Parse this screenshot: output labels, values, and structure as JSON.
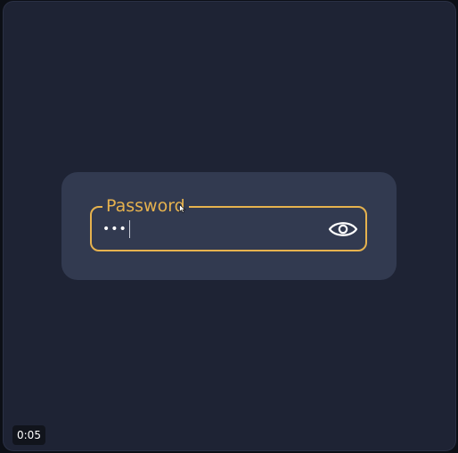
{
  "password_field": {
    "label": "Password",
    "masked_value": "•••",
    "visibility_toggle_icon": "eye-icon"
  },
  "player": {
    "timestamp": "0:05"
  },
  "colors": {
    "background": "#1e2334",
    "card": "#323a50",
    "accent": "#e6b24e",
    "text": "#ffffff"
  }
}
